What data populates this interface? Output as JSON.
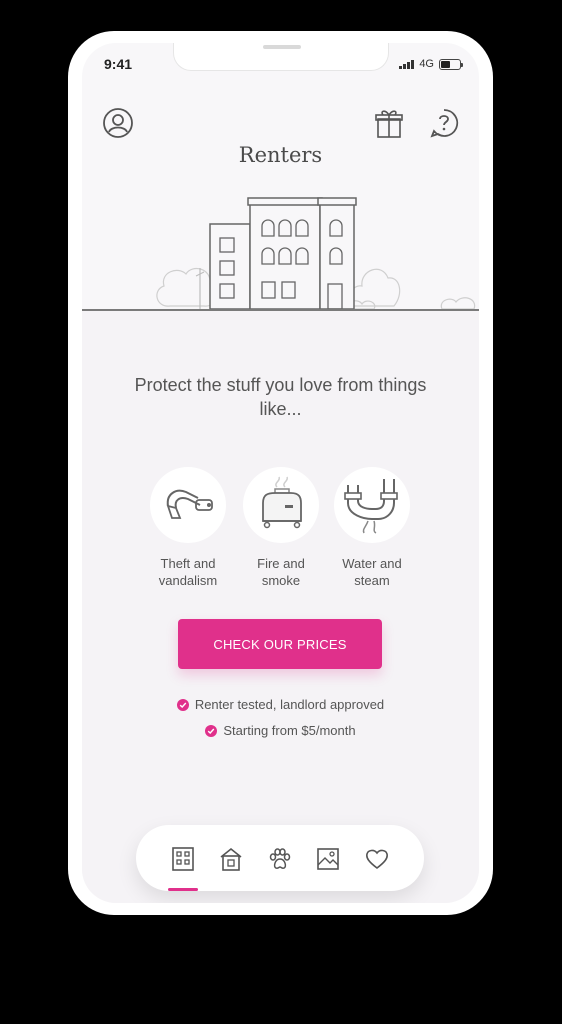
{
  "status_bar": {
    "time": "9:41",
    "network": "4G"
  },
  "header": {
    "profile_icon": "user-circle-icon",
    "gift_icon": "gift-icon",
    "help_icon": "question-bubble-icon"
  },
  "title": "Renters",
  "hero_illustration": "building-illustration",
  "headline": "Protect the stuff you love from things like...",
  "perks": [
    {
      "icon": "lock-icon",
      "label": "Theft and vandalism"
    },
    {
      "icon": "toaster-icon",
      "label": "Fire and smoke"
    },
    {
      "icon": "pipe-leak-icon",
      "label": "Water and steam"
    }
  ],
  "cta": {
    "label": "CHECK OUR PRICES"
  },
  "checks": [
    "Renter tested, landlord approved",
    "Starting from $5/month"
  ],
  "tabbar": {
    "items": [
      "building-icon",
      "house-icon",
      "paw-icon",
      "photo-icon",
      "heart-icon"
    ],
    "active_index": 0
  },
  "colors": {
    "accent": "#e0308b",
    "text": "#555555",
    "background": "#f8f7f9"
  }
}
